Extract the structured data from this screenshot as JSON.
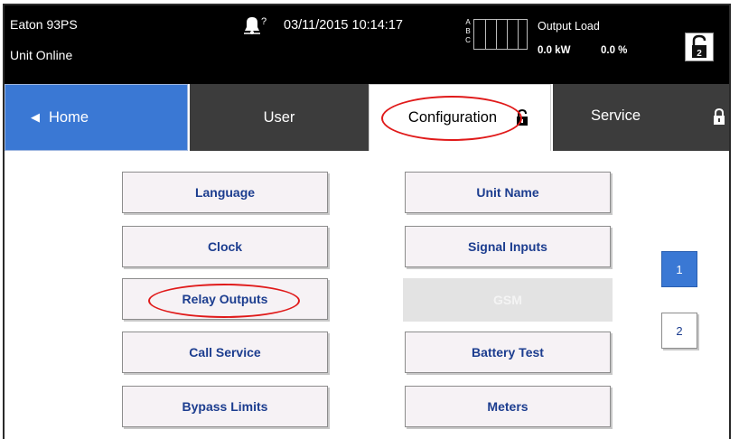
{
  "header": {
    "device_name": "Eaton 93PS",
    "device_status": "Unit Online",
    "alarm_icon": "bell-question-icon",
    "alarm_badge": "?",
    "datetime": "03/11/2015 10:14:17",
    "phases": [
      "A",
      "B",
      "C"
    ],
    "output_load": {
      "label": "Output Load",
      "kw": "0.0 kW",
      "percent": "0.0 %"
    },
    "lock_button_icon": "unlocked-padlock-icon",
    "lock_level": "2"
  },
  "tabs": [
    {
      "id": "home",
      "label": "Home",
      "icon": "left-triangle-icon",
      "active": false
    },
    {
      "id": "user",
      "label": "User",
      "active": false
    },
    {
      "id": "configuration",
      "label": "Configuration",
      "icon": "unlocked-padlock-icon",
      "active": true
    },
    {
      "id": "service",
      "label": "Service",
      "icon": "locked-padlock-icon",
      "active": false
    }
  ],
  "menu": {
    "left": [
      "Language",
      "Clock",
      "Relay Outputs",
      "Call Service",
      "Bypass Limits"
    ],
    "right": [
      "Unit Name",
      "Signal Inputs",
      "GSM",
      "Battery Test",
      "Meters"
    ]
  },
  "pager": {
    "pages": [
      "1",
      "2"
    ],
    "current": "1"
  },
  "colors": {
    "header_bg": "#000000",
    "active_blue": "#3a78d4",
    "tab_dark": "#3c3c3c",
    "button_bg": "#f6f2f5",
    "button_text": "#1c3d8f",
    "annotation_red": "#e01a1a",
    "disabled_bg": "#e3e3e3"
  }
}
